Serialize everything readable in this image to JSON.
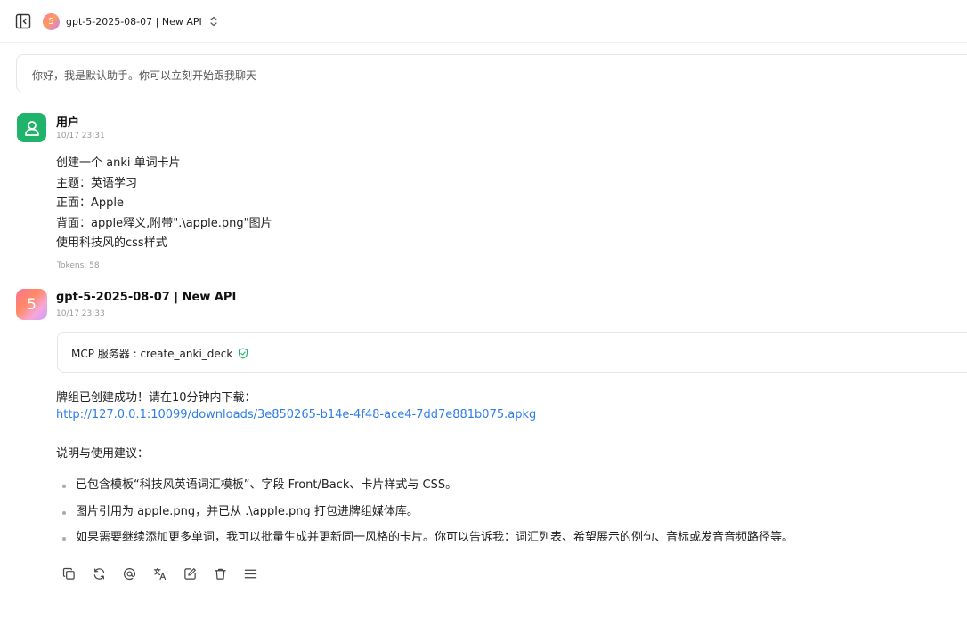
{
  "header": {
    "model_badge": "5",
    "model_name": "gpt-5-2025-08-07 | New API"
  },
  "prompt": {
    "text": "你好，我是默认助手。你可以立刻开始跟我聊天"
  },
  "user_message": {
    "sender": "用户",
    "timestamp": "10/17 23:31",
    "lines": [
      "创建一个 anki 单词卡片",
      "主题：英语学习",
      "正面：Apple",
      "背面：apple释义,附带\".\\apple.png\"图片",
      "使用科技风的css样式"
    ],
    "tokens": "Tokens: 58"
  },
  "assistant_message": {
    "avatar_text": "5",
    "sender": "gpt-5-2025-08-07 | New API",
    "timestamp": "10/17 23:33",
    "tool_call": "MCP 服务器 : create_anki_deck",
    "success_text": "牌组已创建成功！请在10分钟内下载：",
    "download_url": "http://127.0.0.1:10099/downloads/3e850265-b14e-4f48-ace4-7dd7e881b075.apkg",
    "notes_heading": "说明与使用建议：",
    "bullets": [
      "已包含模板“科技风英语词汇模板”、字段 Front/Back、卡片样式与 CSS。",
      "图片引用为 apple.png，并已从 .\\apple.png 打包进牌组媒体库。",
      "如果需要继续添加更多单词，我可以批量生成并更新同一风格的卡片。你可以告诉我：词汇列表、希望展示的例句、音标或发音音频路径等。"
    ]
  },
  "icons": {
    "sidebar_toggle": "sidebar-toggle-icon",
    "chevron": "chevron-up-down-icon",
    "user_avatar": "user-icon",
    "tool_status": "shield-check-icon",
    "actions": [
      "copy-icon",
      "regenerate-icon",
      "mention-icon",
      "translate-icon",
      "edit-icon",
      "delete-icon",
      "menu-icon"
    ]
  },
  "colors": {
    "user_avatar": "#1fb36b",
    "link": "#2f7ee8",
    "verified": "#1fb36b"
  }
}
